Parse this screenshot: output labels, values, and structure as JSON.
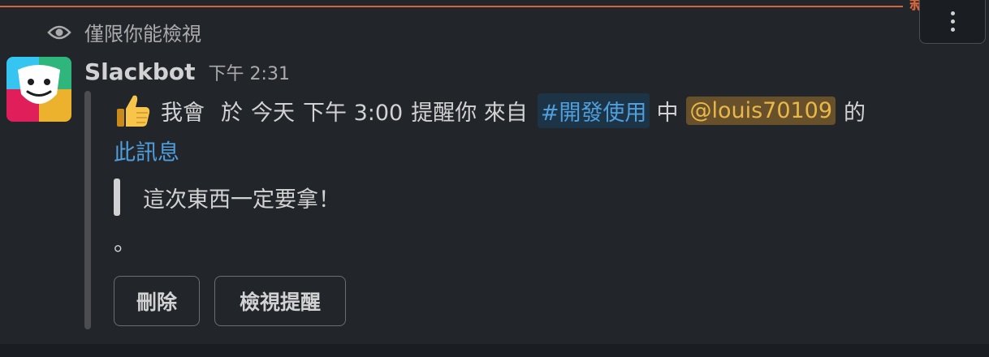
{
  "visibility_notice": "僅限你能檢視",
  "new_marker": "新",
  "message": {
    "sender": "Slackbot",
    "timestamp": "下午 2:31",
    "emoji": "thumbs-up",
    "text_before_time": "我會",
    "text_yu": "於",
    "text_today": "今天",
    "reminder_time": "下午 3:00",
    "text_remind": "提醒你 來自",
    "channel": "#開發使用",
    "text_in": "中",
    "mention": "@louis70109",
    "text_of": "的",
    "message_link": "此訊息",
    "quote": "這次東西一定要拿！",
    "period": "。"
  },
  "buttons": {
    "delete_label": "刪除",
    "view_label": "檢視提醒"
  },
  "colors": {
    "new_divider": "#d4663f",
    "link": "#4f9ede",
    "mention_bg": "#68502b",
    "mention_text": "#e8b84a",
    "channel_bg": "#1d3446"
  },
  "icons": {
    "visibility": "eye-icon",
    "more_actions": "kebab-menu-icon",
    "avatar": "slackbot-avatar-icon",
    "emoji": "thumbs-up-icon"
  }
}
